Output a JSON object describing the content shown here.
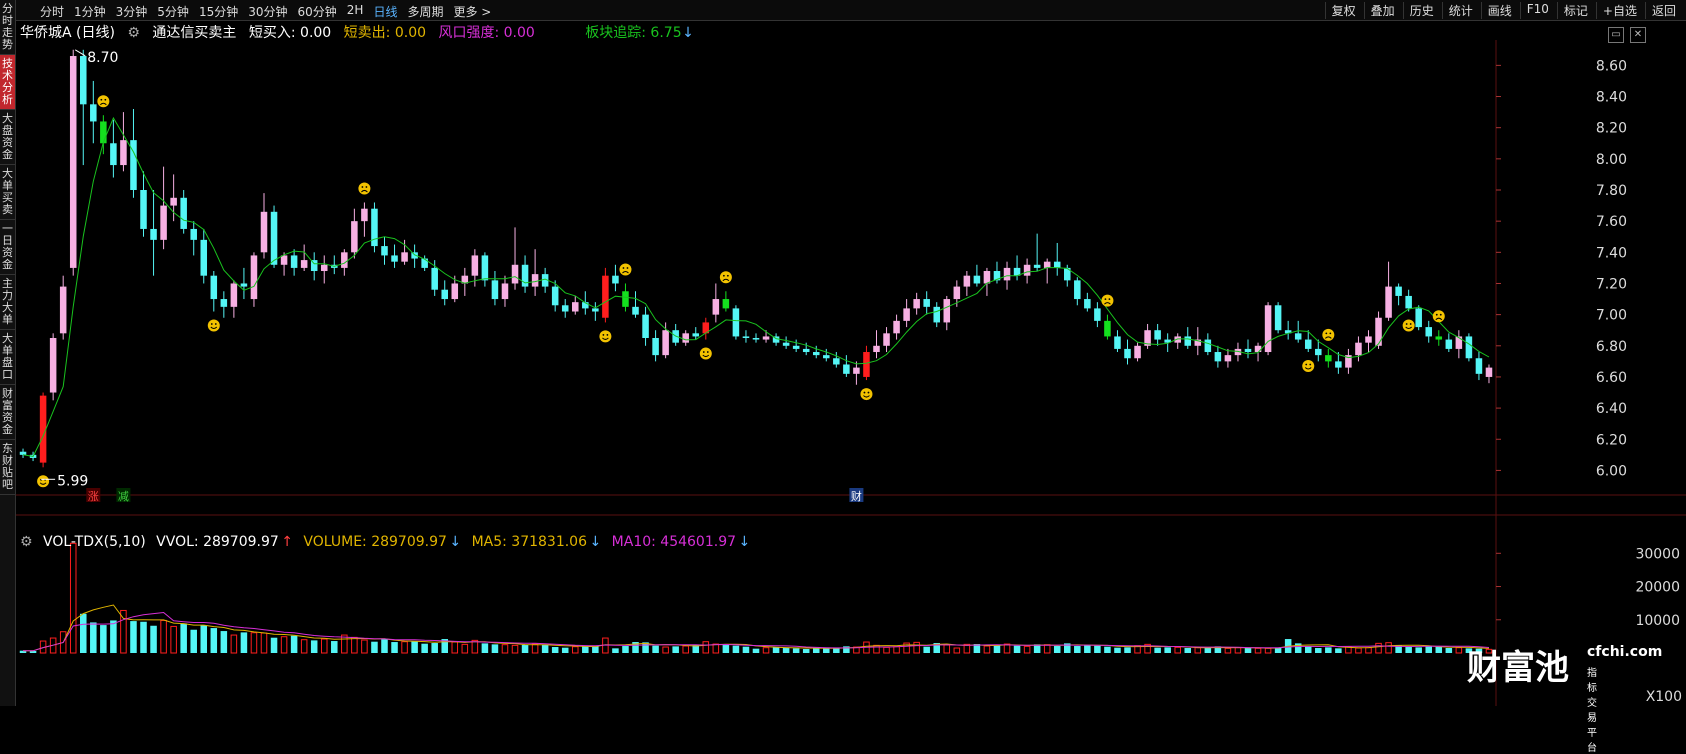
{
  "sidebar": [
    "分时走势",
    "技术分析",
    "大盘资金",
    "大单买卖",
    "一日资金",
    "主力大单",
    "大单盘口",
    "财富资金",
    "东财贴吧"
  ],
  "sidebar_active": 1,
  "topbar": {
    "period_tabs": [
      "分时",
      "1分钟",
      "3分钟",
      "5分钟",
      "15分钟",
      "30分钟",
      "60分钟",
      "2H",
      "日线",
      "多周期",
      "更多 >"
    ],
    "active_period": 8,
    "tools": [
      "复权",
      "叠加",
      "历史",
      "统计",
      "画线",
      "F10",
      "标记",
      "+自选",
      "返回"
    ]
  },
  "info": {
    "stock": "华侨城A (日线)",
    "indicator": "通达信买卖主",
    "buy": "短买入: 0.00",
    "sell": "短卖出: 0.00",
    "risk": "风口强度: 0.00",
    "sector": "板块追踪: 6.75"
  },
  "vol_info": {
    "name": "VOL-TDX(5,10)",
    "vvol": "VVOL: 289709.97",
    "volume": "VOLUME: 289709.97",
    "ma5": "MA5: 371831.06",
    "ma10": "MA10: 454601.97"
  },
  "annotations": {
    "high": "8.70",
    "low": "5.99",
    "tag_zhang": "涨",
    "tag_jian": "减",
    "tag_cai": "财"
  },
  "unit": "X100",
  "colors": {
    "up": "#ff1e1e",
    "up_hollow": "#f7b0e3",
    "down": "#54f5f5",
    "signal_buy": "#ff1e1e",
    "signal_sell": "#14e01e",
    "ma": "#19c21e",
    "vol_ma5": "#e0b400",
    "vol_ma10": "#d62fd6",
    "grid": "#3a0a0a"
  },
  "watermark": {
    "logo": "财富池",
    "site": "cfchi.com",
    "sub": "指标交易平台"
  },
  "chart_data": [
    {
      "type": "candlestick",
      "y_axis_ticks": [
        "8.60",
        "8.40",
        "8.20",
        "8.00",
        "7.80",
        "7.60",
        "7.40",
        "7.20",
        "7.00",
        "6.80",
        "6.60",
        "6.40",
        "6.20",
        "6.00"
      ],
      "ylim": [
        5.9,
        8.75
      ],
      "candles": [
        [
          6.12,
          6.14,
          6.08,
          6.1
        ],
        [
          6.1,
          6.12,
          6.06,
          6.08
        ],
        [
          6.05,
          6.5,
          6.02,
          6.48
        ],
        [
          6.5,
          6.88,
          6.45,
          6.85
        ],
        [
          6.88,
          7.25,
          6.84,
          7.18
        ],
        [
          7.3,
          8.7,
          7.25,
          8.66
        ],
        [
          8.66,
          8.7,
          7.96,
          8.35
        ],
        [
          8.35,
          8.5,
          8.1,
          8.24
        ],
        [
          8.24,
          8.28,
          8.03,
          8.1
        ],
        [
          8.1,
          8.25,
          7.88,
          7.96
        ],
        [
          7.96,
          8.3,
          7.92,
          8.12
        ],
        [
          8.12,
          8.32,
          7.75,
          7.8
        ],
        [
          7.8,
          7.92,
          7.5,
          7.55
        ],
        [
          7.55,
          7.8,
          7.25,
          7.48
        ],
        [
          7.48,
          7.95,
          7.42,
          7.7
        ],
        [
          7.7,
          7.9,
          7.6,
          7.75
        ],
        [
          7.75,
          7.8,
          7.52,
          7.55
        ],
        [
          7.55,
          7.6,
          7.38,
          7.48
        ],
        [
          7.48,
          7.55,
          7.2,
          7.25
        ],
        [
          7.25,
          7.28,
          7.02,
          7.1
        ],
        [
          7.1,
          7.15,
          6.98,
          7.05
        ],
        [
          7.05,
          7.22,
          6.98,
          7.2
        ],
        [
          7.2,
          7.3,
          7.1,
          7.18
        ],
        [
          7.1,
          7.4,
          7.05,
          7.38
        ],
        [
          7.4,
          7.78,
          7.36,
          7.66
        ],
        [
          7.66,
          7.7,
          7.3,
          7.32
        ],
        [
          7.32,
          7.4,
          7.25,
          7.38
        ],
        [
          7.38,
          7.42,
          7.25,
          7.3
        ],
        [
          7.3,
          7.45,
          7.28,
          7.35
        ],
        [
          7.35,
          7.4,
          7.22,
          7.28
        ],
        [
          7.28,
          7.38,
          7.2,
          7.32
        ],
        [
          7.32,
          7.38,
          7.26,
          7.3
        ],
        [
          7.3,
          7.42,
          7.25,
          7.4
        ],
        [
          7.4,
          7.68,
          7.36,
          7.6
        ],
        [
          7.6,
          7.72,
          7.5,
          7.68
        ],
        [
          7.68,
          7.72,
          7.4,
          7.44
        ],
        [
          7.44,
          7.5,
          7.32,
          7.38
        ],
        [
          7.38,
          7.45,
          7.3,
          7.34
        ],
        [
          7.34,
          7.48,
          7.32,
          7.4
        ],
        [
          7.4,
          7.45,
          7.3,
          7.36
        ],
        [
          7.36,
          7.38,
          7.28,
          7.3
        ],
        [
          7.3,
          7.35,
          7.12,
          7.16
        ],
        [
          7.16,
          7.22,
          7.06,
          7.1
        ],
        [
          7.1,
          7.25,
          7.08,
          7.2
        ],
        [
          7.2,
          7.3,
          7.12,
          7.25
        ],
        [
          7.25,
          7.42,
          7.18,
          7.38
        ],
        [
          7.38,
          7.4,
          7.18,
          7.22
        ],
        [
          7.22,
          7.28,
          7.06,
          7.1
        ],
        [
          7.1,
          7.25,
          7.05,
          7.2
        ],
        [
          7.2,
          7.56,
          7.16,
          7.32
        ],
        [
          7.32,
          7.38,
          7.14,
          7.18
        ],
        [
          7.18,
          7.42,
          7.12,
          7.26
        ],
        [
          7.26,
          7.3,
          7.14,
          7.18
        ],
        [
          7.18,
          7.22,
          7.02,
          7.06
        ],
        [
          7.06,
          7.1,
          6.98,
          7.02
        ],
        [
          7.02,
          7.12,
          7.0,
          7.08
        ],
        [
          7.08,
          7.15,
          7.0,
          7.04
        ],
        [
          7.04,
          7.08,
          6.96,
          7.02
        ],
        [
          6.98,
          7.3,
          6.95,
          7.25
        ],
        [
          7.25,
          7.32,
          7.15,
          7.2
        ],
        [
          7.15,
          7.2,
          7.02,
          7.05
        ],
        [
          7.05,
          7.15,
          6.98,
          7.0
        ],
        [
          7.0,
          7.05,
          6.8,
          6.85
        ],
        [
          6.85,
          6.9,
          6.7,
          6.74
        ],
        [
          6.74,
          6.95,
          6.72,
          6.9
        ],
        [
          6.9,
          6.94,
          6.8,
          6.82
        ],
        [
          6.82,
          6.9,
          6.8,
          6.88
        ],
        [
          6.88,
          6.92,
          6.84,
          6.86
        ],
        [
          6.88,
          6.98,
          6.84,
          6.95
        ],
        [
          7.0,
          7.2,
          6.95,
          7.1
        ],
        [
          7.1,
          7.15,
          7.02,
          7.04
        ],
        [
          7.04,
          7.06,
          6.84,
          6.86
        ],
        [
          6.86,
          6.9,
          6.82,
          6.85
        ],
        [
          6.85,
          6.88,
          6.82,
          6.84
        ],
        [
          6.84,
          6.9,
          6.82,
          6.86
        ],
        [
          6.86,
          6.88,
          6.8,
          6.82
        ],
        [
          6.82,
          6.86,
          6.78,
          6.8
        ],
        [
          6.8,
          6.84,
          6.76,
          6.78
        ],
        [
          6.78,
          6.82,
          6.74,
          6.76
        ],
        [
          6.76,
          6.8,
          6.72,
          6.74
        ],
        [
          6.74,
          6.78,
          6.7,
          6.72
        ],
        [
          6.72,
          6.76,
          6.66,
          6.68
        ],
        [
          6.68,
          6.74,
          6.6,
          6.62
        ],
        [
          6.62,
          6.7,
          6.55,
          6.66
        ],
        [
          6.6,
          6.8,
          6.58,
          6.76
        ],
        [
          6.76,
          6.9,
          6.72,
          6.8
        ],
        [
          6.8,
          6.92,
          6.76,
          6.88
        ],
        [
          6.88,
          7.0,
          6.84,
          6.96
        ],
        [
          6.96,
          7.1,
          6.92,
          7.04
        ],
        [
          7.04,
          7.14,
          7.0,
          7.1
        ],
        [
          7.1,
          7.15,
          7.0,
          7.05
        ],
        [
          7.05,
          7.08,
          6.92,
          6.95
        ],
        [
          6.95,
          7.12,
          6.9,
          7.1
        ],
        [
          7.1,
          7.22,
          7.05,
          7.18
        ],
        [
          7.18,
          7.28,
          7.12,
          7.25
        ],
        [
          7.25,
          7.32,
          7.18,
          7.2
        ],
        [
          7.2,
          7.3,
          7.12,
          7.28
        ],
        [
          7.28,
          7.34,
          7.2,
          7.22
        ],
        [
          7.22,
          7.34,
          7.16,
          7.3
        ],
        [
          7.3,
          7.38,
          7.22,
          7.25
        ],
        [
          7.25,
          7.36,
          7.2,
          7.32
        ],
        [
          7.32,
          7.52,
          7.28,
          7.3
        ],
        [
          7.3,
          7.36,
          7.2,
          7.34
        ],
        [
          7.34,
          7.46,
          7.25,
          7.3
        ],
        [
          7.3,
          7.32,
          7.18,
          7.22
        ],
        [
          7.22,
          7.24,
          7.06,
          7.1
        ],
        [
          7.1,
          7.14,
          7.02,
          7.04
        ],
        [
          7.04,
          7.08,
          6.92,
          6.96
        ],
        [
          6.96,
          7.0,
          6.84,
          6.86
        ],
        [
          6.86,
          6.9,
          6.76,
          6.78
        ],
        [
          6.78,
          6.84,
          6.68,
          6.72
        ],
        [
          6.72,
          6.82,
          6.7,
          6.8
        ],
        [
          6.8,
          6.94,
          6.78,
          6.9
        ],
        [
          6.9,
          6.94,
          6.8,
          6.84
        ],
        [
          6.84,
          6.88,
          6.76,
          6.82
        ],
        [
          6.82,
          6.88,
          6.78,
          6.86
        ],
        [
          6.86,
          6.92,
          6.78,
          6.8
        ],
        [
          6.8,
          6.92,
          6.74,
          6.84
        ],
        [
          6.84,
          6.88,
          6.74,
          6.76
        ],
        [
          6.76,
          6.8,
          6.66,
          6.7
        ],
        [
          6.7,
          6.78,
          6.66,
          6.74
        ],
        [
          6.74,
          6.82,
          6.7,
          6.78
        ],
        [
          6.78,
          6.84,
          6.72,
          6.76
        ],
        [
          6.76,
          6.82,
          6.7,
          6.8
        ],
        [
          6.76,
          7.08,
          6.74,
          7.06
        ],
        [
          7.06,
          7.08,
          6.88,
          6.9
        ],
        [
          6.9,
          6.96,
          6.84,
          6.88
        ],
        [
          6.88,
          6.96,
          6.82,
          6.84
        ],
        [
          6.84,
          6.9,
          6.76,
          6.78
        ],
        [
          6.78,
          6.84,
          6.7,
          6.74
        ],
        [
          6.74,
          6.78,
          6.66,
          6.7
        ],
        [
          6.7,
          6.76,
          6.62,
          6.66
        ],
        [
          6.66,
          6.78,
          6.62,
          6.74
        ],
        [
          6.74,
          6.86,
          6.7,
          6.82
        ],
        [
          6.82,
          6.9,
          6.76,
          6.86
        ],
        [
          6.8,
          7.02,
          6.78,
          6.98
        ],
        [
          6.98,
          7.34,
          6.96,
          7.18
        ],
        [
          7.18,
          7.2,
          7.06,
          7.12
        ],
        [
          7.12,
          7.16,
          7.02,
          7.04
        ],
        [
          7.04,
          7.06,
          6.9,
          6.92
        ],
        [
          6.92,
          6.96,
          6.82,
          6.86
        ],
        [
          6.86,
          6.9,
          6.8,
          6.84
        ],
        [
          6.84,
          6.88,
          6.76,
          6.78
        ],
        [
          6.78,
          6.9,
          6.72,
          6.86
        ],
        [
          6.86,
          6.88,
          6.7,
          6.72
        ],
        [
          6.72,
          6.76,
          6.58,
          6.62
        ],
        [
          6.6,
          6.68,
          6.56,
          6.66
        ]
      ],
      "signals": [
        {
          "i": 2,
          "kind": "happy"
        },
        {
          "i": 8,
          "kind": "sad"
        },
        {
          "i": 19,
          "kind": "happy"
        },
        {
          "i": 34,
          "kind": "sad"
        },
        {
          "i": 58,
          "kind": "happy"
        },
        {
          "i": 60,
          "kind": "sad"
        },
        {
          "i": 68,
          "kind": "happy"
        },
        {
          "i": 70,
          "kind": "sad"
        },
        {
          "i": 84,
          "kind": "happy"
        },
        {
          "i": 108,
          "kind": "sad"
        },
        {
          "i": 128,
          "kind": "happy"
        },
        {
          "i": 130,
          "kind": "sad"
        },
        {
          "i": 138,
          "kind": "happy"
        },
        {
          "i": 141,
          "kind": "sad"
        }
      ]
    },
    {
      "type": "bar",
      "y_axis_ticks": [
        "30000",
        "20000",
        "10000"
      ],
      "ylim": [
        0,
        34000
      ],
      "volumes": [
        700,
        600,
        3600,
        4500,
        6400,
        33000,
        11800,
        9200,
        8400,
        9800,
        12800,
        9600,
        9400,
        8200,
        9800,
        8000,
        8900,
        7000,
        8300,
        7500,
        6600,
        5400,
        6200,
        6100,
        6000,
        4600,
        4900,
        5200,
        4000,
        3800,
        4200,
        3600,
        5400,
        4700,
        3900,
        3400,
        4100,
        3300,
        3400,
        3600,
        2800,
        3000,
        4200,
        3300,
        2600,
        3800,
        2900,
        2600,
        2500,
        2300,
        2400,
        2700,
        2500,
        1800,
        1600,
        1900,
        2100,
        2200,
        4500,
        1400,
        2100,
        3300,
        3200,
        2200,
        1800,
        2000,
        2100,
        2400,
        3400,
        2700,
        2600,
        2200,
        1900,
        1300,
        1600,
        1800,
        1500,
        1400,
        1200,
        1400,
        1600,
        1500,
        2000,
        1800,
        3300,
        2300,
        1700,
        1900,
        3000,
        3200,
        1900,
        3000,
        2400,
        1500,
        2600,
        2700,
        2100,
        2400,
        2700,
        2200,
        2000,
        2600,
        2500,
        2100,
        2900,
        2100,
        2300,
        2200,
        1900,
        1600,
        1700,
        2200,
        2600,
        1600,
        1700,
        1700,
        1500,
        1600,
        1500,
        2000,
        1400,
        1600,
        1500,
        1400,
        1400,
        1600,
        4200,
        2900,
        2000,
        1500,
        1700,
        1400,
        1900,
        1500,
        1600,
        2900,
        3100,
        2300,
        1800,
        1700,
        2000,
        1900,
        1500,
        1600,
        1400,
        1300,
        1100
      ]
    }
  ]
}
